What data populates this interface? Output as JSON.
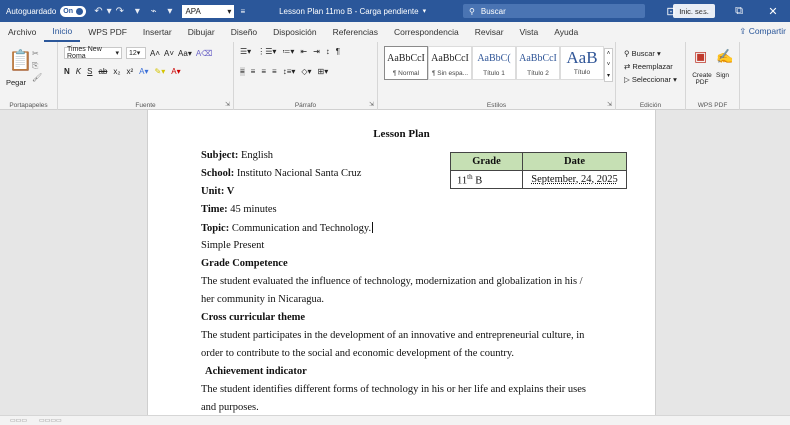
{
  "titlebar": {
    "autosave_label": "Autoguardado",
    "autosave_state": "On",
    "style_box": "APA",
    "doc_title": "Lesson Plan 11mo B - Carga pendiente",
    "search_placeholder": "Buscar",
    "signin": "Inic. ses."
  },
  "menu": {
    "tabs": [
      "Archivo",
      "Inicio",
      "WPS PDF",
      "Insertar",
      "Dibujar",
      "Diseño",
      "Disposición",
      "Referencias",
      "Correspondencia",
      "Revisar",
      "Vista",
      "Ayuda"
    ],
    "active": "Inicio",
    "share": "Compartir"
  },
  "ribbon": {
    "clipboard": {
      "paste": "Pegar",
      "label": "Portapapeles"
    },
    "font": {
      "name": "Times New Roma",
      "size": "12",
      "label": "Fuente"
    },
    "paragraph": {
      "label": "Párrafo"
    },
    "styles": {
      "label": "Estilos",
      "items": [
        {
          "sample": "AaBbCcI",
          "name": "¶ Normal"
        },
        {
          "sample": "AaBbCcI",
          "name": "¶ Sin espa..."
        },
        {
          "sample": "AaBbC(",
          "name": "Título 1"
        },
        {
          "sample": "AaBbCcI",
          "name": "Título 2"
        },
        {
          "sample": "AaB",
          "name": "Título"
        }
      ]
    },
    "editing": {
      "search": "Buscar",
      "replace": "Reemplazar",
      "select": "Seleccionar",
      "label": "Edición"
    },
    "wps": {
      "create_pdf": "Create PDF",
      "sign": "Sign",
      "label": "WPS PDF"
    }
  },
  "document": {
    "heading": "Lesson Plan",
    "subject_label": "Subject:",
    "subject_value": "English",
    "school_label": "School:",
    "school_value": "Instituto Nacional Santa Cruz",
    "unit": "Unit: V",
    "time_label": "Time:",
    "time_value": "45 minutes",
    "topic_label": "Topic:",
    "topic_value": "Communication and Technology.",
    "line_simple_present": "Simple Present",
    "grade_competence_heading": "Grade Competence",
    "grade_competence_1": "The student evaluated the influence of technology, modernization and globalization in his /",
    "grade_competence_2": "her community in Nicaragua.",
    "cross_heading": "Cross curricular theme",
    "cross_1": "The student participates in the development of an innovative and entrepreneurial culture, in",
    "cross_2": "order to contribute to the social and economic development of the country.",
    "achievement_heading": "Achievement indicator",
    "achievement_1": "The student identifies different forms of technology in his or her life and explains their uses",
    "achievement_2": "and purposes.",
    "table": {
      "headers": [
        "Grade",
        "Date"
      ],
      "grade_value": "11",
      "grade_sup": "th",
      "grade_suffix": " B",
      "date_value": "September, 24, 2025"
    }
  },
  "colors": {
    "titlebar": "#2b579a",
    "table_header": "#c6e0b4"
  }
}
